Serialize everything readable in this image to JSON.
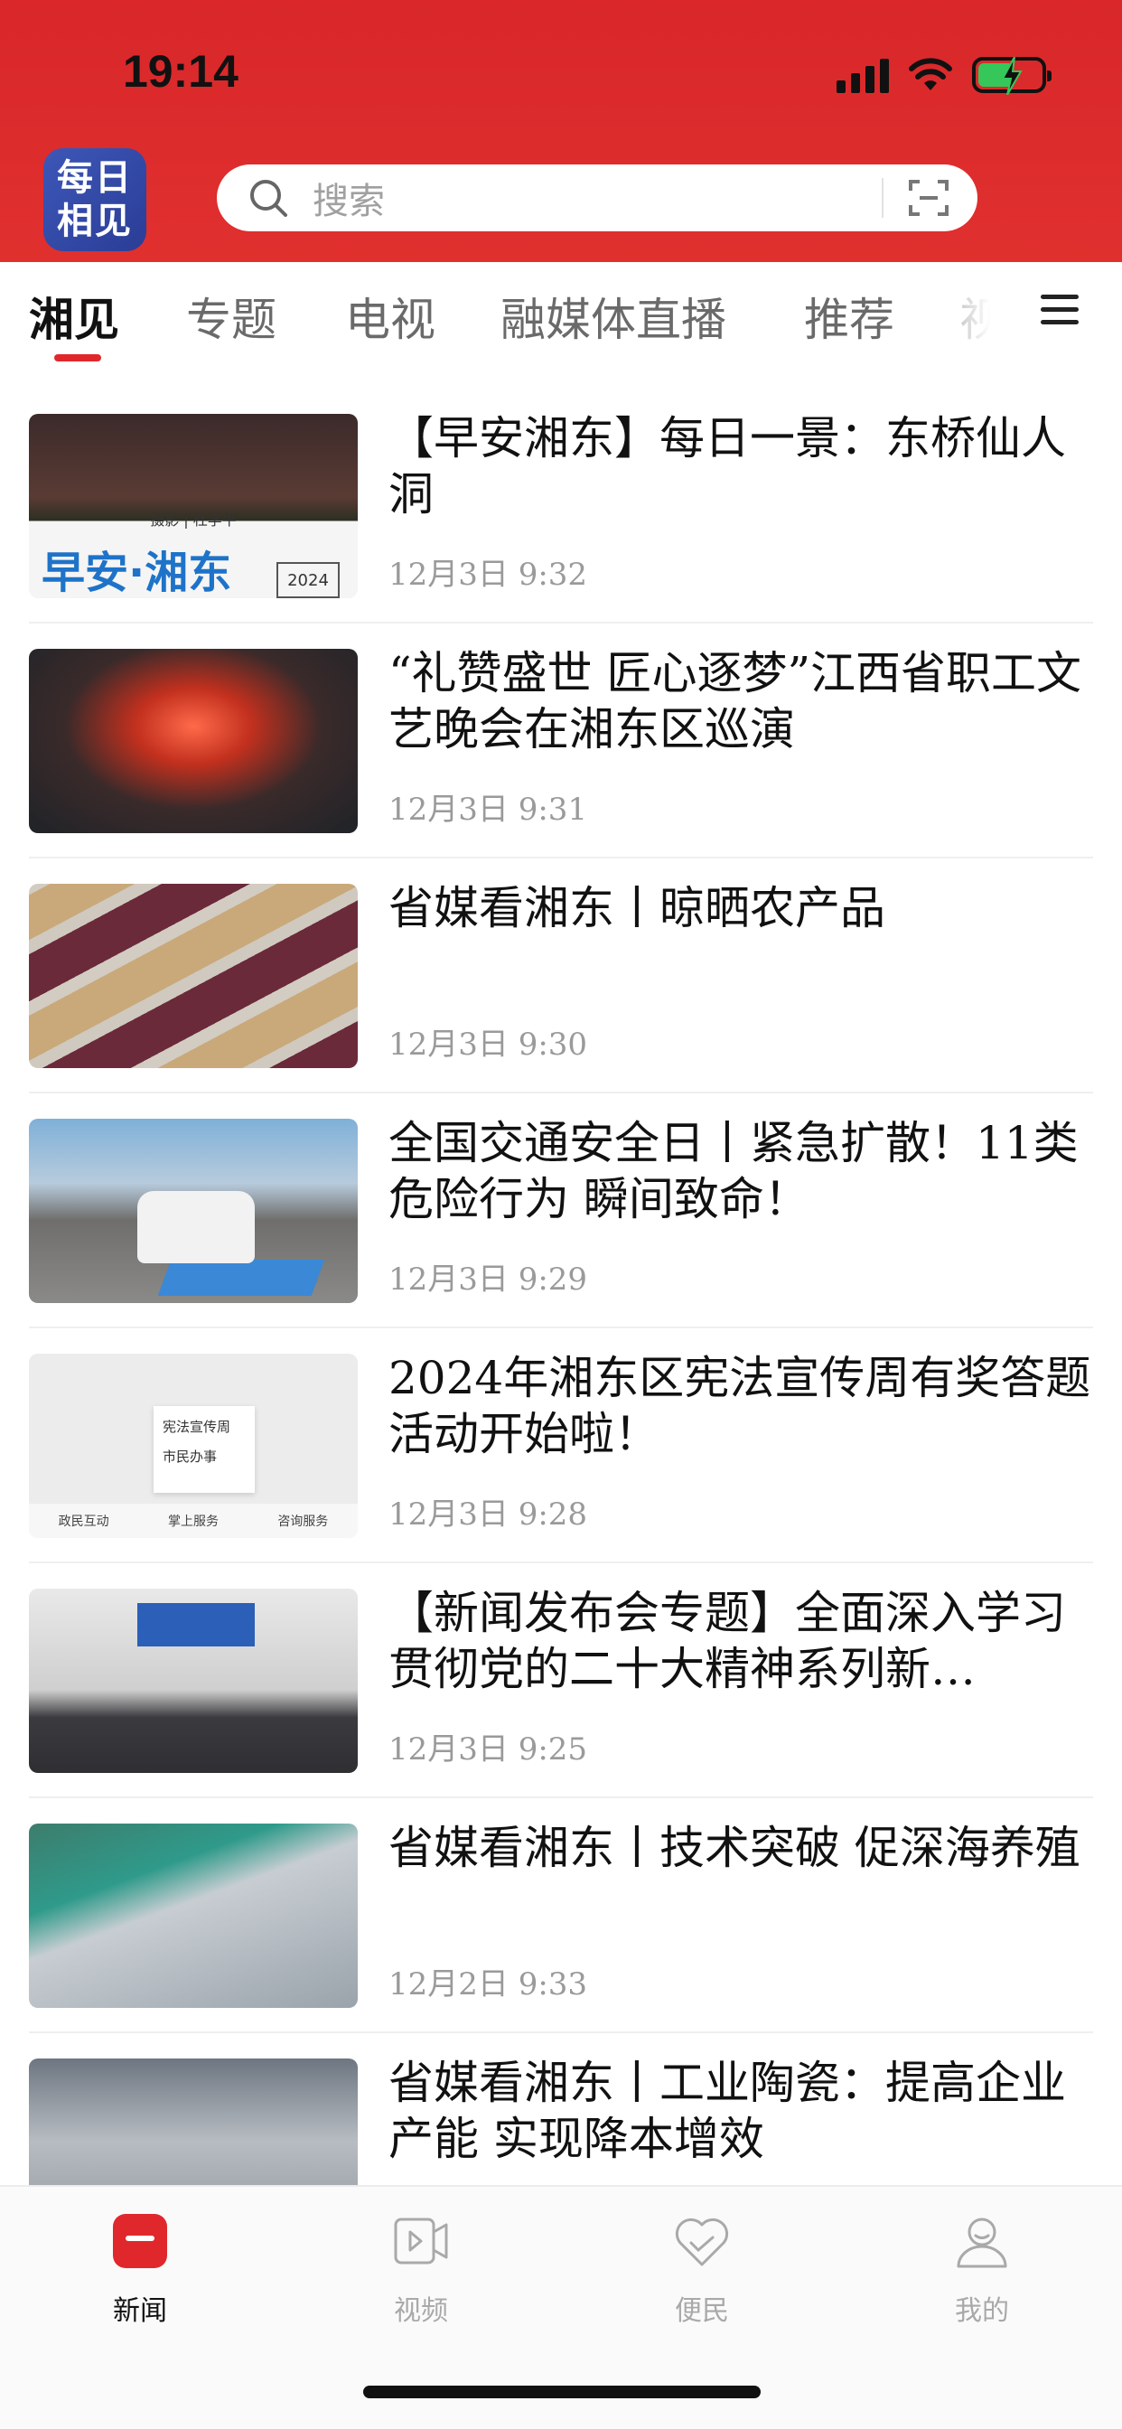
{
  "status_bar": {
    "time": "19:14"
  },
  "app": {
    "logo_line1": "每日",
    "logo_line2": "相见"
  },
  "search": {
    "placeholder": "搜索"
  },
  "tabs": [
    {
      "label": "湘见",
      "active": true
    },
    {
      "label": "专题"
    },
    {
      "label": "电视"
    },
    {
      "label": "融媒体直播"
    },
    {
      "label": "推荐"
    },
    {
      "label": "视"
    }
  ],
  "news": [
    {
      "title": "【早安湘东】每日一景：东桥仙人洞",
      "date": "12月3日  9:32",
      "thumb_caption": "摄影 | 杜学平",
      "thumb_big_text": "早安·湘东",
      "thumb_year": "2024"
    },
    {
      "title": "“礼赞盛世 匠心逐梦”江西省职工文艺晚会在湘东区巡演",
      "date": "12月3日  9:31"
    },
    {
      "title": "省媒看湘东丨晾晒农产品",
      "date": "12月3日  9:30"
    },
    {
      "title": "全国交通安全日丨紧急扩散！11类危险行为 瞬间致命！",
      "date": "12月3日  9:29"
    },
    {
      "title": "2024年湘东区宪法宣传周有奖答题活动开始啦！",
      "date": "12月3日  9:28",
      "thumb_menu": [
        "宪法宣传周",
        "市民办事"
      ],
      "thumb_bar": [
        "政民互动",
        "掌上服务",
        "咨询服务"
      ]
    },
    {
      "title": "【新闻发布会专题】全面深入学习贯彻党的二十大精神系列新…",
      "date": "12月3日  9:25"
    },
    {
      "title": "省媒看湘东丨技术突破 促深海养殖",
      "date": "12月2日  9:33"
    },
    {
      "title": "省媒看湘东丨工业陶瓷：提高企业产能 实现降本增效",
      "date": ""
    }
  ],
  "bottom_nav": [
    {
      "label": "新闻",
      "icon": "news-icon",
      "active": true
    },
    {
      "label": "视频",
      "icon": "video-icon"
    },
    {
      "label": "便民",
      "icon": "heart-icon"
    },
    {
      "label": "我的",
      "icon": "profile-icon"
    }
  ],
  "colors": {
    "brand_red": "#e0282c",
    "header_red": "#d9272a"
  }
}
